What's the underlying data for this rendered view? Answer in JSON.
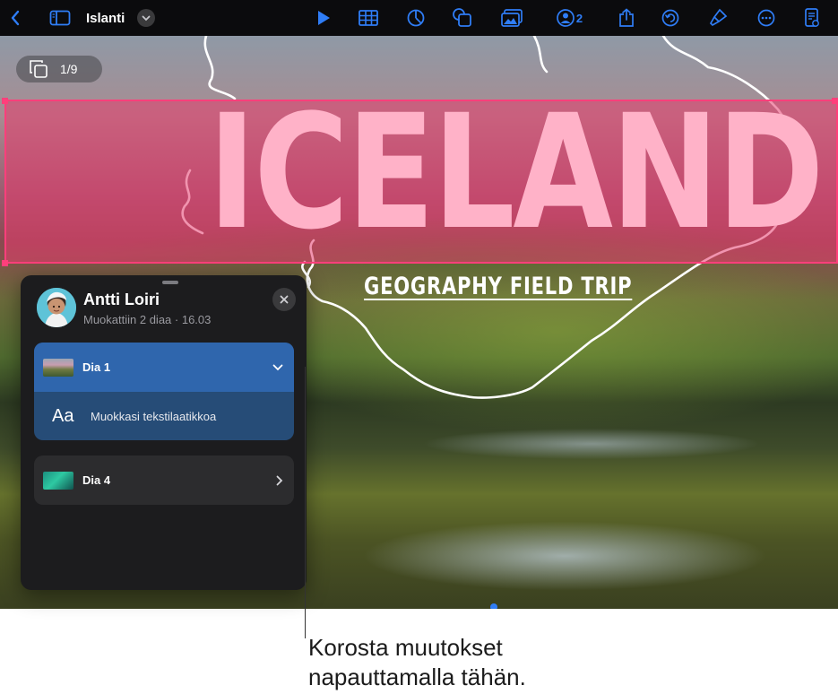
{
  "toolbar": {
    "document_title": "Islanti",
    "collaborator_count": "2",
    "icons": [
      "back-icon",
      "sidebar-icon",
      "title-menu-chevron-icon",
      "play-icon",
      "table-icon",
      "chart-icon",
      "shape-icon",
      "media-icon",
      "collaborate-icon",
      "share-icon",
      "undo-icon",
      "format-brush-icon",
      "more-icon",
      "document-icon"
    ],
    "accent_color": "#2f7df6"
  },
  "canvas": {
    "slide_counter": "1/9",
    "slide_title": "ICELAND",
    "slide_subtitle": "GEOGRAPHY FIELD TRIP",
    "highlight_color": "#ff3f7b"
  },
  "activity_panel": {
    "user_name": "Antti Loiri",
    "meta": "Muokattiin 2 diaa · 16.03",
    "groups": [
      {
        "label": "Dia 1",
        "expanded": true,
        "changes": [
          {
            "icon": "Aa",
            "text": "Muokkasi tekstilaatikkoa"
          }
        ]
      },
      {
        "label": "Dia 4",
        "expanded": false,
        "changes": []
      }
    ]
  },
  "callout": {
    "line1": "Korosta muutokset",
    "line2": "napauttamalla tähän."
  }
}
